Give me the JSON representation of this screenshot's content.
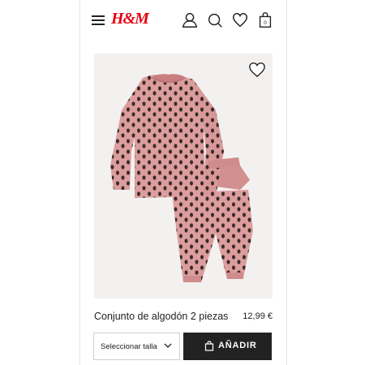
{
  "header": {
    "brand": "H&M",
    "icons": [
      "menu-icon",
      "account-icon",
      "search-icon",
      "favorites-icon",
      "shopping-bag-icon"
    ],
    "bag_count": "0"
  },
  "product": {
    "name": "Conjunto de algodón 2 piezas",
    "price": "12,99 €",
    "image_colors": {
      "garment": "#dc9d9d",
      "dots": "#3a2a2c",
      "background": "#f2f1ef"
    }
  },
  "actions": {
    "size_placeholder": "Seleccionar talla",
    "add_label": "AÑADIR"
  },
  "colors": {
    "brand_red": "#e50010",
    "button_dark": "#222222",
    "text": "#222222"
  }
}
